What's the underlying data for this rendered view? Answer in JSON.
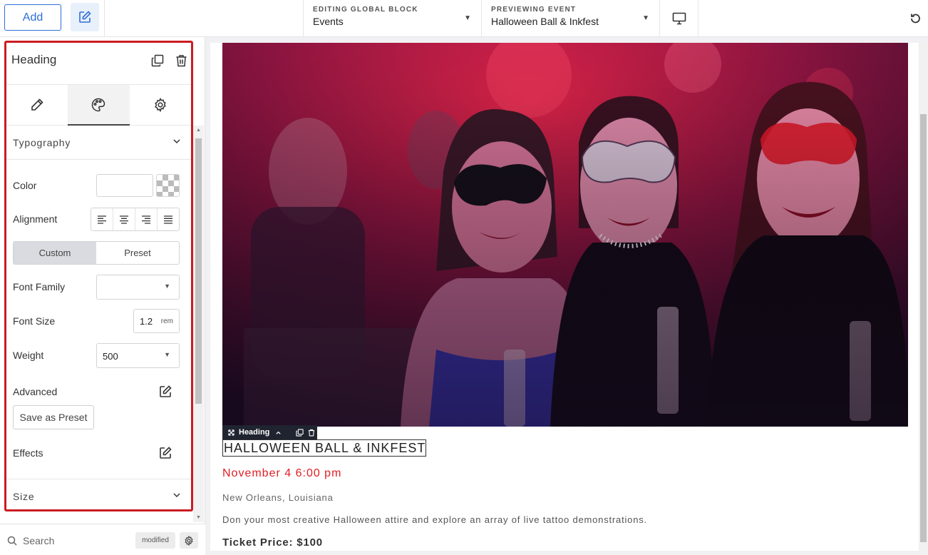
{
  "topbar": {
    "add_label": "Add",
    "editing_label": "EDITING GLOBAL BLOCK",
    "editing_value": "Events",
    "preview_label": "PREVIEWING EVENT",
    "preview_value": "Halloween Ball & Inkfest"
  },
  "panel": {
    "title": "Heading",
    "tabs": [
      "edit",
      "style",
      "settings"
    ],
    "active_tab": "style",
    "typography": {
      "header": "Typography",
      "color_label": "Color",
      "alignment_label": "Alignment",
      "custom_label": "Custom",
      "preset_label": "Preset",
      "font_family_label": "Font Family",
      "font_family_value": "",
      "font_size_label": "Font Size",
      "font_size_value": "1.2",
      "font_size_unit": "rem",
      "weight_label": "Weight",
      "weight_value": "500",
      "advanced_label": "Advanced",
      "save_preset_label": "Save as Preset",
      "effects_label": "Effects"
    },
    "size_header": "Size",
    "search_placeholder": "Search",
    "modified_badge": "modified"
  },
  "canvas": {
    "toolbar_label": "Heading",
    "heading": "HALLOWEEN BALL & INKFEST",
    "date": "November 4 6:00 pm",
    "location": "New Orleans, Louisiana",
    "description": "Don your most creative Halloween attire and explore an array of live tattoo demonstrations.",
    "price": "Ticket Price: $100"
  },
  "colors": {
    "accent_blue": "#2e6fd6",
    "highlight_red": "#cc1b22",
    "date_red": "#e01e24"
  }
}
